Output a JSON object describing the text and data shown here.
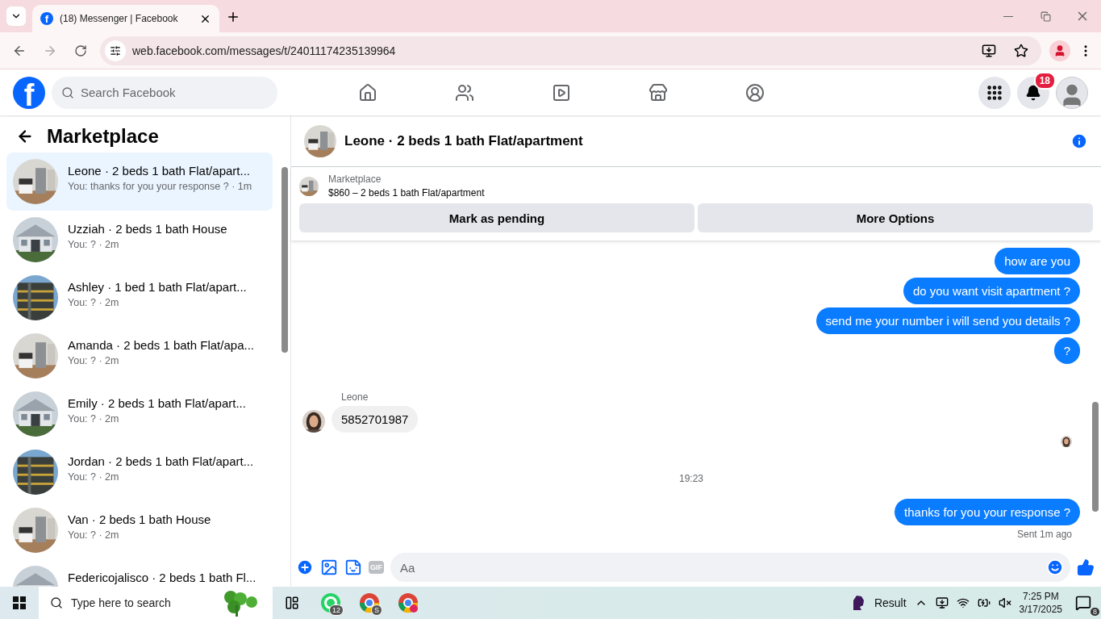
{
  "browser": {
    "tab": {
      "favicon": "f",
      "title": "(18) Messenger | Facebook"
    },
    "url": "web.facebook.com/messages/t/24011174235139964"
  },
  "header": {
    "logo": "f",
    "search": {
      "placeholder": "Search Facebook"
    },
    "notifications": "18"
  },
  "sidebar": {
    "title": "Marketplace",
    "items": [
      {
        "title": "Leone · 2 beds 1 bath Flat/apart...",
        "subtitle": "You: thanks for you your response ? · 1m",
        "selected": true
      },
      {
        "title": "Uzziah · 2 beds 1 bath House",
        "subtitle": "You: ? · 2m",
        "selected": false
      },
      {
        "title": "Ashley · 1 bed 1 bath Flat/apart...",
        "subtitle": "You: ? · 2m",
        "selected": false
      },
      {
        "title": "Amanda · 2 beds 1 bath Flat/apa...",
        "subtitle": "You: ? · 2m",
        "selected": false
      },
      {
        "title": "Emily · 2 beds 1 bath Flat/apart...",
        "subtitle": "You: ? · 2m",
        "selected": false
      },
      {
        "title": "Jordan · 2 beds 1 bath Flat/apart...",
        "subtitle": "You: ? · 2m",
        "selected": false
      },
      {
        "title": "Van · 2 beds 1 bath House",
        "subtitle": "You: ? · 2m",
        "selected": false
      },
      {
        "title": "Federicojalisco · 2 beds 1 bath Fl...",
        "selected": false
      }
    ]
  },
  "chat": {
    "title": "Leone · 2 beds 1 bath Flat/apartment",
    "listing": {
      "label": "Marketplace",
      "title": "$860 – 2 beds 1 bath Flat/apartment"
    },
    "actions": [
      "Mark as pending",
      "More Options"
    ],
    "messages": [
      {
        "kind": "outgoing",
        "text": "how are you"
      },
      {
        "kind": "outgoing",
        "text": "do you want visit apartment ?"
      },
      {
        "kind": "outgoing",
        "text": "send me your number i will send you details ?"
      },
      {
        "kind": "outgoing",
        "text": "?"
      },
      {
        "kind": "incoming",
        "sender": "Leone",
        "text": "5852701987"
      },
      {
        "kind": "seen"
      },
      {
        "kind": "timestamp",
        "text": "19:23"
      },
      {
        "kind": "outgoing",
        "text": "thanks for you your response ?"
      },
      {
        "kind": "status",
        "text": "Sent 1m ago"
      }
    ],
    "composer": {
      "gif": "GIF",
      "placeholder": "Aa"
    }
  },
  "taskbar": {
    "search": {
      "placeholder": "Type here to search"
    },
    "whatsapp_badge": "12",
    "chrome_badge": "S",
    "weather": "Result",
    "time": "7:25 PM",
    "date": "3/17/2025",
    "notifications": "8"
  }
}
